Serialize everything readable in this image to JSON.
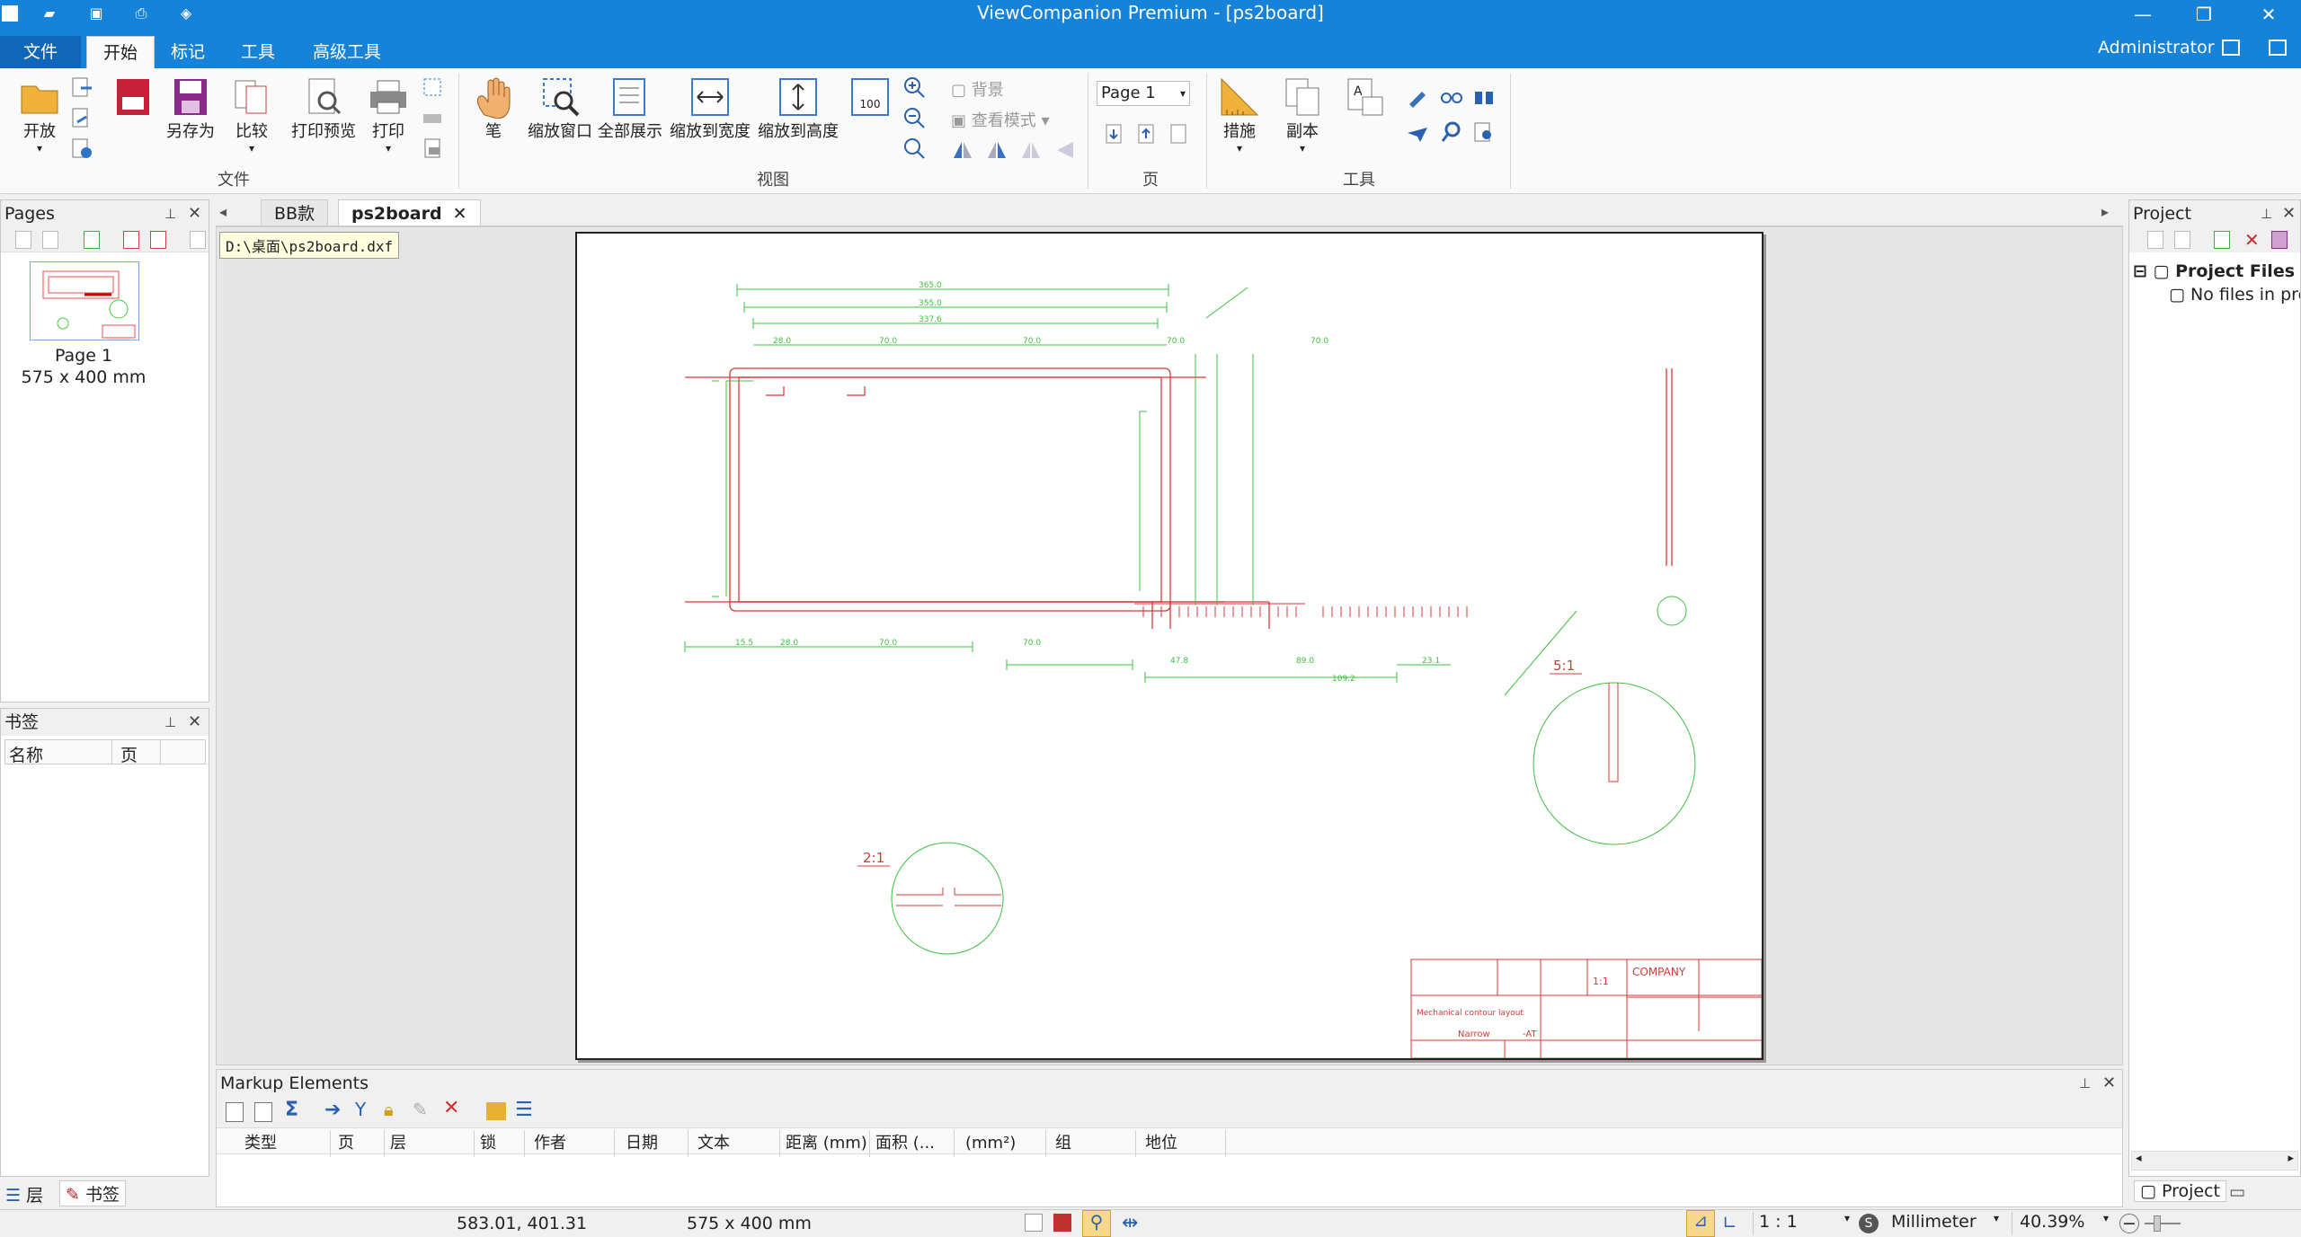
{
  "window": {
    "title": "ViewCompanion Premium - [ps2board]"
  },
  "ribbon_tabs": [
    "文件",
    "开始",
    "标记",
    "工具",
    "高级工具"
  ],
  "user": "Administrator",
  "ribbon": {
    "file_group": {
      "label": "文件",
      "open": "开放",
      "save_as": "另存为",
      "compare": "比较",
      "print_preview": "打印预览",
      "print": "打印"
    },
    "view_group": {
      "label": "视图",
      "pen": "笔",
      "zoom_window": "缩放窗口",
      "show_all": "全部展示",
      "zoom_width": "缩放到宽度",
      "zoom_height": "缩放到高度",
      "background": "背景",
      "view_mode": "查看模式"
    },
    "page_group": {
      "label": "页",
      "page_select": "Page 1"
    },
    "tools_group": {
      "label": "工具",
      "measure": "措施",
      "copy": "副本"
    }
  },
  "pages_panel": {
    "title": "Pages",
    "page_label": "Page 1",
    "page_size": "575 x 400 mm"
  },
  "bookmarks_panel": {
    "title": "书签",
    "col_name": "名称",
    "col_page": "页"
  },
  "bottom_left_tabs": {
    "layers": "层",
    "bookmarks": "书签"
  },
  "doc_tabs": [
    "BB款",
    "ps2board"
  ],
  "file_path": "D:\\桌面\\ps2board.dxf",
  "project_panel": {
    "title": "Project",
    "root": "Project Files",
    "child": "No files in pro",
    "tab": "Project"
  },
  "markup": {
    "title": "Markup Elements",
    "columns": [
      "类型",
      "页",
      "层",
      "锁",
      "作者",
      "日期",
      "文本",
      "距离 (mm)",
      "面积 (...",
      "(mm²)",
      "组",
      "地位"
    ]
  },
  "drawing": {
    "scale_5": "5:1",
    "scale_2": "2:1",
    "company": "COMPANY",
    "ratio": "1:1",
    "layout_title": "Mechanical contour layout",
    "narrow": "Narrow",
    "at": "-AT",
    "dims_top": [
      "365.0",
      "355.0",
      "337.6"
    ],
    "dims_seg": [
      "28.0",
      "70.0",
      "70.0",
      "70.0",
      "70.0"
    ],
    "dims_bottom": [
      "15.5",
      "28.0",
      "70.0",
      "70.0"
    ],
    "dims_bottom2": [
      "47.8",
      "89.0",
      "23.1",
      "109.2"
    ]
  },
  "status": {
    "coords": "583.01, 401.31",
    "size": "575 x 400 mm",
    "scale": "1 : 1",
    "unit": "Millimeter",
    "zoom": "40.39%"
  }
}
